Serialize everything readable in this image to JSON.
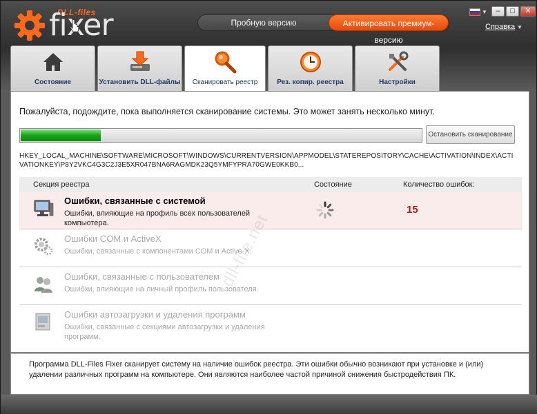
{
  "logo": {
    "small": "DLL-files",
    "big": "fixer"
  },
  "header": {
    "trial_label": "Пробную версию",
    "premium_label": "Активировать премиум-версию",
    "help_label": "Справка"
  },
  "window_buttons": {
    "minimize": "–",
    "maximize": "□",
    "close": "✕"
  },
  "tabs": [
    {
      "label": "Состояние",
      "icon": "house-icon"
    },
    {
      "label": "Установить DLL-файлы",
      "icon": "download-disk-icon"
    },
    {
      "label": "Сканировать реестр",
      "icon": "magnifier-icon"
    },
    {
      "label": "Рез. копир. реестра",
      "icon": "clock-backup-icon"
    },
    {
      "label": "Настройки",
      "icon": "tools-icon"
    }
  ],
  "active_tab": 2,
  "scan": {
    "wait_text": "Пожалуйста, подождите, пока выполняется сканирование системы. Это может занять несколько минут.",
    "progress": 0.2,
    "stop_label": "Остановить сканирование",
    "path": "HKEY_LOCAL_MACHINE\\SOFTWARE\\MICROSOFT\\WINDOWS\\CURRENTVERSION\\APPMODEL\\STATEREPOSITORY\\CACHE\\ACTIVATION\\INDEX\\ACTIVATIONKEY\\P8Y2VKC4G3C2J3E5XR047BNA6RAGMDK23Q5YMFYPRA70GWE0KKB0..."
  },
  "table": {
    "col_section": "Секция реестра",
    "col_state": "Состояние",
    "col_errors": "Количество ошибок:",
    "rows": [
      {
        "title": "Ошибки, связанные с системой",
        "desc": "Ошибки, влияющие на профиль всех пользователей компьютера.",
        "errors": "15",
        "icon": "computer-icon"
      },
      {
        "title": "Ошибки COM и ActiveX",
        "desc": "Ошибки, связанные с компонентами COM и Active-X.",
        "icon": "gears-icon"
      },
      {
        "title": "Ошибки, связанные с пользователем",
        "desc": "Ошибки, влияющие на личный профиль пользователя.",
        "icon": "users-icon"
      },
      {
        "title": "Ошибки автозагрузки и удаления программ",
        "desc": "Ошибки, связанные с секциями автозагрузки и удаления программ.",
        "icon": "install-box-icon"
      }
    ]
  },
  "watermark": "dll-file.net",
  "info_text": "Программа DLL-Files Fixer сканирует систему на наличие ошибок реестра. Эти ошибки обычно возникают при установке и (или) удалении различных программ на компьютере. Они являются наиболее частой причиной снижения быстродействия ПК.",
  "colors": {
    "accent": "#ff6a1a",
    "progress_green": "#19a419",
    "error_red": "#b01818"
  }
}
